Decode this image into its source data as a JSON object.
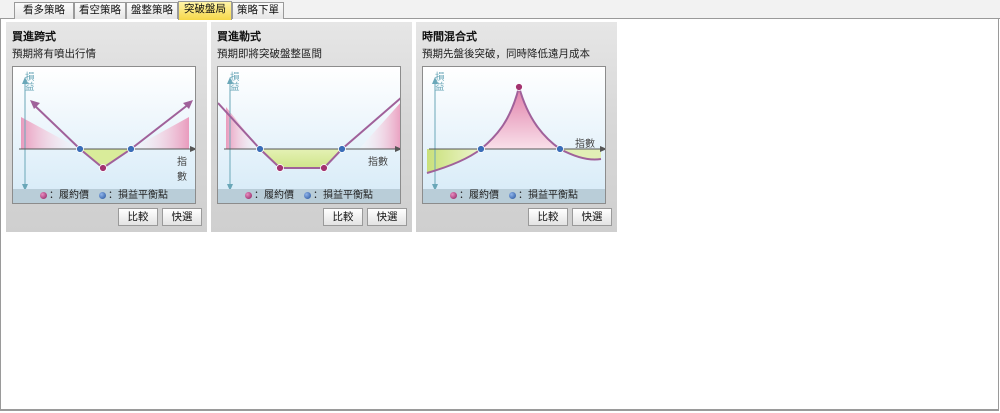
{
  "tabs": [
    {
      "label": "看多策略",
      "active": false
    },
    {
      "label": "看空策略",
      "active": false
    },
    {
      "label": "盤整策略",
      "active": false
    },
    {
      "label": "突破盤局",
      "active": true
    },
    {
      "label": "策略下單",
      "active": false
    }
  ],
  "legend": {
    "strike_label": "：履約價",
    "breakeven_label": "：損益平衡點"
  },
  "axis": {
    "pl_label": "損益",
    "index_label": "指數"
  },
  "buttons": {
    "compare": "比較",
    "quick": "快選"
  },
  "colors": {
    "active_tab": "#f6d84a",
    "profit_fill": "#f2bccf",
    "loss_fill": "#d9ec9a",
    "curve": "#a0619a"
  },
  "cards": [
    {
      "title": "買進跨式",
      "desc": "預期將有噴出行情",
      "shape": "straddle"
    },
    {
      "title": "買進勒式",
      "desc": "預期即將突破盤整區間",
      "shape": "strangle"
    },
    {
      "title": "時間混合式",
      "desc": "預期先盤後突破，同時降低遠月成本",
      "shape": "calendar"
    }
  ]
}
